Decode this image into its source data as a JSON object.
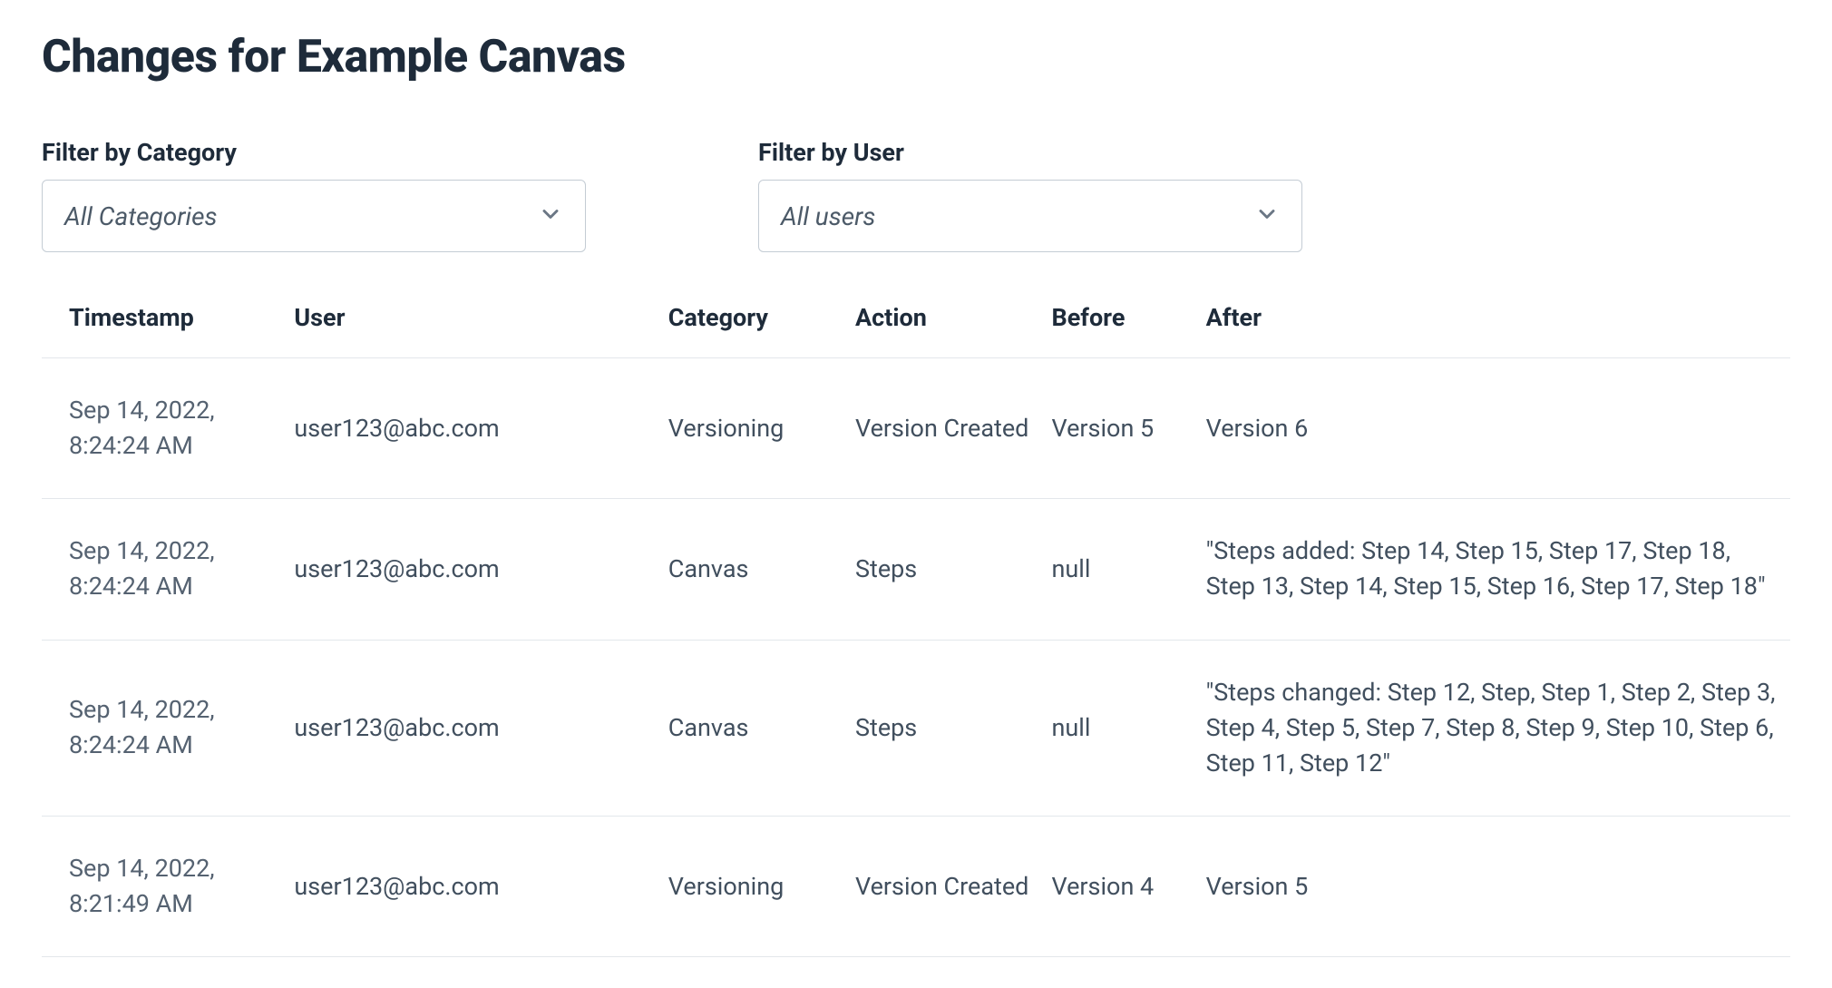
{
  "title": "Changes for Example Canvas",
  "filters": {
    "category": {
      "label": "Filter by Category",
      "value": "All Categories"
    },
    "user": {
      "label": "Filter by User",
      "value": "All users"
    }
  },
  "columns": {
    "timestamp": "Timestamp",
    "user": "User",
    "category": "Category",
    "action": "Action",
    "before": "Before",
    "after": "After"
  },
  "rows": [
    {
      "timestamp": "Sep 14, 2022, 8:24:24 AM",
      "user": "user123@abc.com",
      "category": "Versioning",
      "action": "Version Created",
      "before": "Version 5",
      "after": "Version 6"
    },
    {
      "timestamp": "Sep 14, 2022, 8:24:24 AM",
      "user": "user123@abc.com",
      "category": "Canvas",
      "action": "Steps",
      "before": "null",
      "after": "\"Steps added: Step 14, Step 15, Step 17, Step 18, Step 13, Step 14, Step 15, Step 16, Step 17, Step 18\""
    },
    {
      "timestamp": "Sep 14, 2022, 8:24:24 AM",
      "user": "user123@abc.com",
      "category": "Canvas",
      "action": "Steps",
      "before": "null",
      "after": "\"Steps changed: Step 12, Step, Step 1, Step 2, Step 3, Step 4, Step 5, Step 7, Step 8, Step 9, Step 10, Step 6, Step 11, Step 12\""
    },
    {
      "timestamp": "Sep 14, 2022, 8:21:49 AM",
      "user": "user123@abc.com",
      "category": "Versioning",
      "action": "Version Created",
      "before": "Version 4",
      "after": "Version 5"
    }
  ]
}
